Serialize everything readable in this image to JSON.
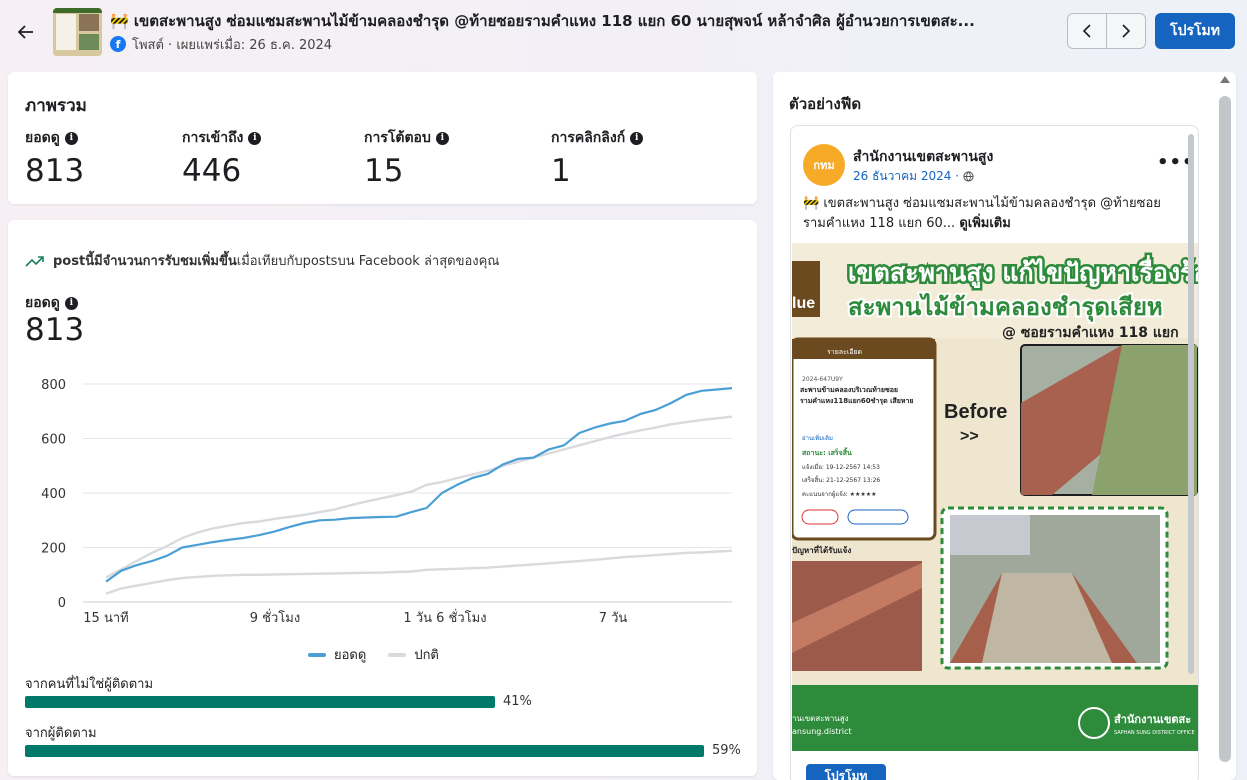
{
  "header": {
    "title": "🚧 เขตสะพานสูง ซ่อมแซมสะพานไม้ข้ามคลองชำรุด @ท้ายซอยรามคำแหง 118 แยก 60 นายสุพจน์ หล้าจำศิล ผู้อำนวยการเขตสะ...",
    "meta": "โพสต์ · เผยแพร่เมื่อ: 26 ธ.ค. 2024",
    "promote_label": "โปรโมท"
  },
  "overview": {
    "title": "ภาพรวม",
    "metrics": [
      {
        "label": "ยอดดู",
        "value": "813"
      },
      {
        "label": "การเข้าถึง",
        "value": "446"
      },
      {
        "label": "การโต้ตอบ",
        "value": "15"
      },
      {
        "label": "การคลิกลิงก์",
        "value": "1"
      }
    ]
  },
  "performance": {
    "insight_bold": "postนี้มีจำนวนการรับชมเพิ่มขึ้น",
    "insight_rest": "เมื่อเทียบกับpostsบน Facebook ล่าสุดของคุณ",
    "insight_prefix": "",
    "views_label": "ยอดดู",
    "views_value": "813",
    "audience": [
      {
        "label": "จากคนที่ไม่ใช่ผู้ติดตาม",
        "percent": 41,
        "pct_text": "41%"
      },
      {
        "label": "จากผู้ติดตาม",
        "percent": 59,
        "pct_text": "59%"
      }
    ],
    "bar_color": "#00796b"
  },
  "chart_data": {
    "type": "line",
    "x": [
      "15 นาที",
      "9 ชั่วโมง",
      "1 วัน 6 ชั่วโมง",
      "7 วัน"
    ],
    "ylim": [
      0,
      800
    ],
    "yticks": [
      0,
      200,
      400,
      600,
      800
    ],
    "grid": true,
    "legend_position": "bottom",
    "series": [
      {
        "name": "ยอดดู",
        "color": "#4a9fd5",
        "values": [
          75,
          115,
          135,
          150,
          170,
          200,
          210,
          220,
          228,
          235,
          245,
          258,
          275,
          290,
          300,
          302,
          308,
          310,
          312,
          313,
          330,
          345,
          400,
          430,
          455,
          470,
          505,
          525,
          530,
          560,
          575,
          620,
          640,
          655,
          665,
          690,
          705,
          730,
          760,
          775,
          780,
          785
        ]
      },
      {
        "name": "ปกติ",
        "color": "#d8dadd",
        "values": [
          90,
          120,
          150,
          180,
          205,
          235,
          255,
          270,
          280,
          290,
          295,
          305,
          312,
          320,
          330,
          340,
          355,
          368,
          380,
          392,
          405,
          430,
          440,
          455,
          468,
          482,
          500,
          515,
          530,
          545,
          560,
          575,
          590,
          605,
          618,
          630,
          640,
          652,
          660,
          668,
          674,
          680
        ]
      },
      {
        "name": "",
        "color": "#d8dadd",
        "values": [
          30,
          50,
          60,
          70,
          80,
          88,
          92,
          96,
          98,
          100,
          100,
          101,
          102,
          103,
          104,
          105,
          106,
          107,
          108,
          110,
          112,
          118,
          120,
          122,
          124,
          126,
          130,
          134,
          138,
          142,
          146,
          150,
          155,
          160,
          165,
          168,
          172,
          176,
          180,
          182,
          185,
          188
        ]
      }
    ]
  },
  "feed": {
    "title": "ตัวอย่างฟีด",
    "page_name": "สำนักงานเขตสะพานสูง",
    "avatar_text": "กทม",
    "date": "26 ธันวาคม 2024 ·",
    "text": "🚧 เขตสะพานสูง  ซ่อมแซมสะพานไม้ข้ามคลองชำรุด @ท้ายซอยรามคำแหง 118 แยก 60...",
    "see_more": "ดูเพิ่มเติม",
    "cta": "โปรโมท",
    "image": {
      "headline1": "เขตสะพานสูง แก้ไขปัญหาเรื่องร้อ",
      "headline2": "สะพานไม้ข้ามคลองชำรุดเสียห",
      "sub": "@ ซอยรามคำแหง 118 แยก",
      "card_header": "รายละเอียด",
      "card_id": "2024-647U9Y",
      "card_desc": "สะพานข้ามคลองบริเวณท้ายซอยรามคำแหง118แยก60ชำรุด เสียหาย",
      "card_more": "อ่านเพิ่มเติม",
      "card_status": "สถานะ: เสร็จสิ้น",
      "card_notified": "แจ้งเมื่อ: 19-12-2567 14:53",
      "card_done": "เสร็จสิ้น: 21-12-2567 13:26",
      "card_rating": "คะแนนจากผู้แจ้ง: ★★★★★",
      "before_label": "Before",
      "before_arrow": ">>",
      "fixed_label": "ปัญหาที่ได้รับแจ้ง",
      "brand_side": "lue",
      "footer_left1": "านเขตสะพานสูง",
      "footer_left2": "ansung.district",
      "footer_right": "สำนักงานเขตสะ",
      "footer_right_sub": "SAPHAN SUNG DISTRICT OFFICE",
      "accent_green": "#2e8b3c",
      "brown": "#6b4a1f"
    }
  }
}
